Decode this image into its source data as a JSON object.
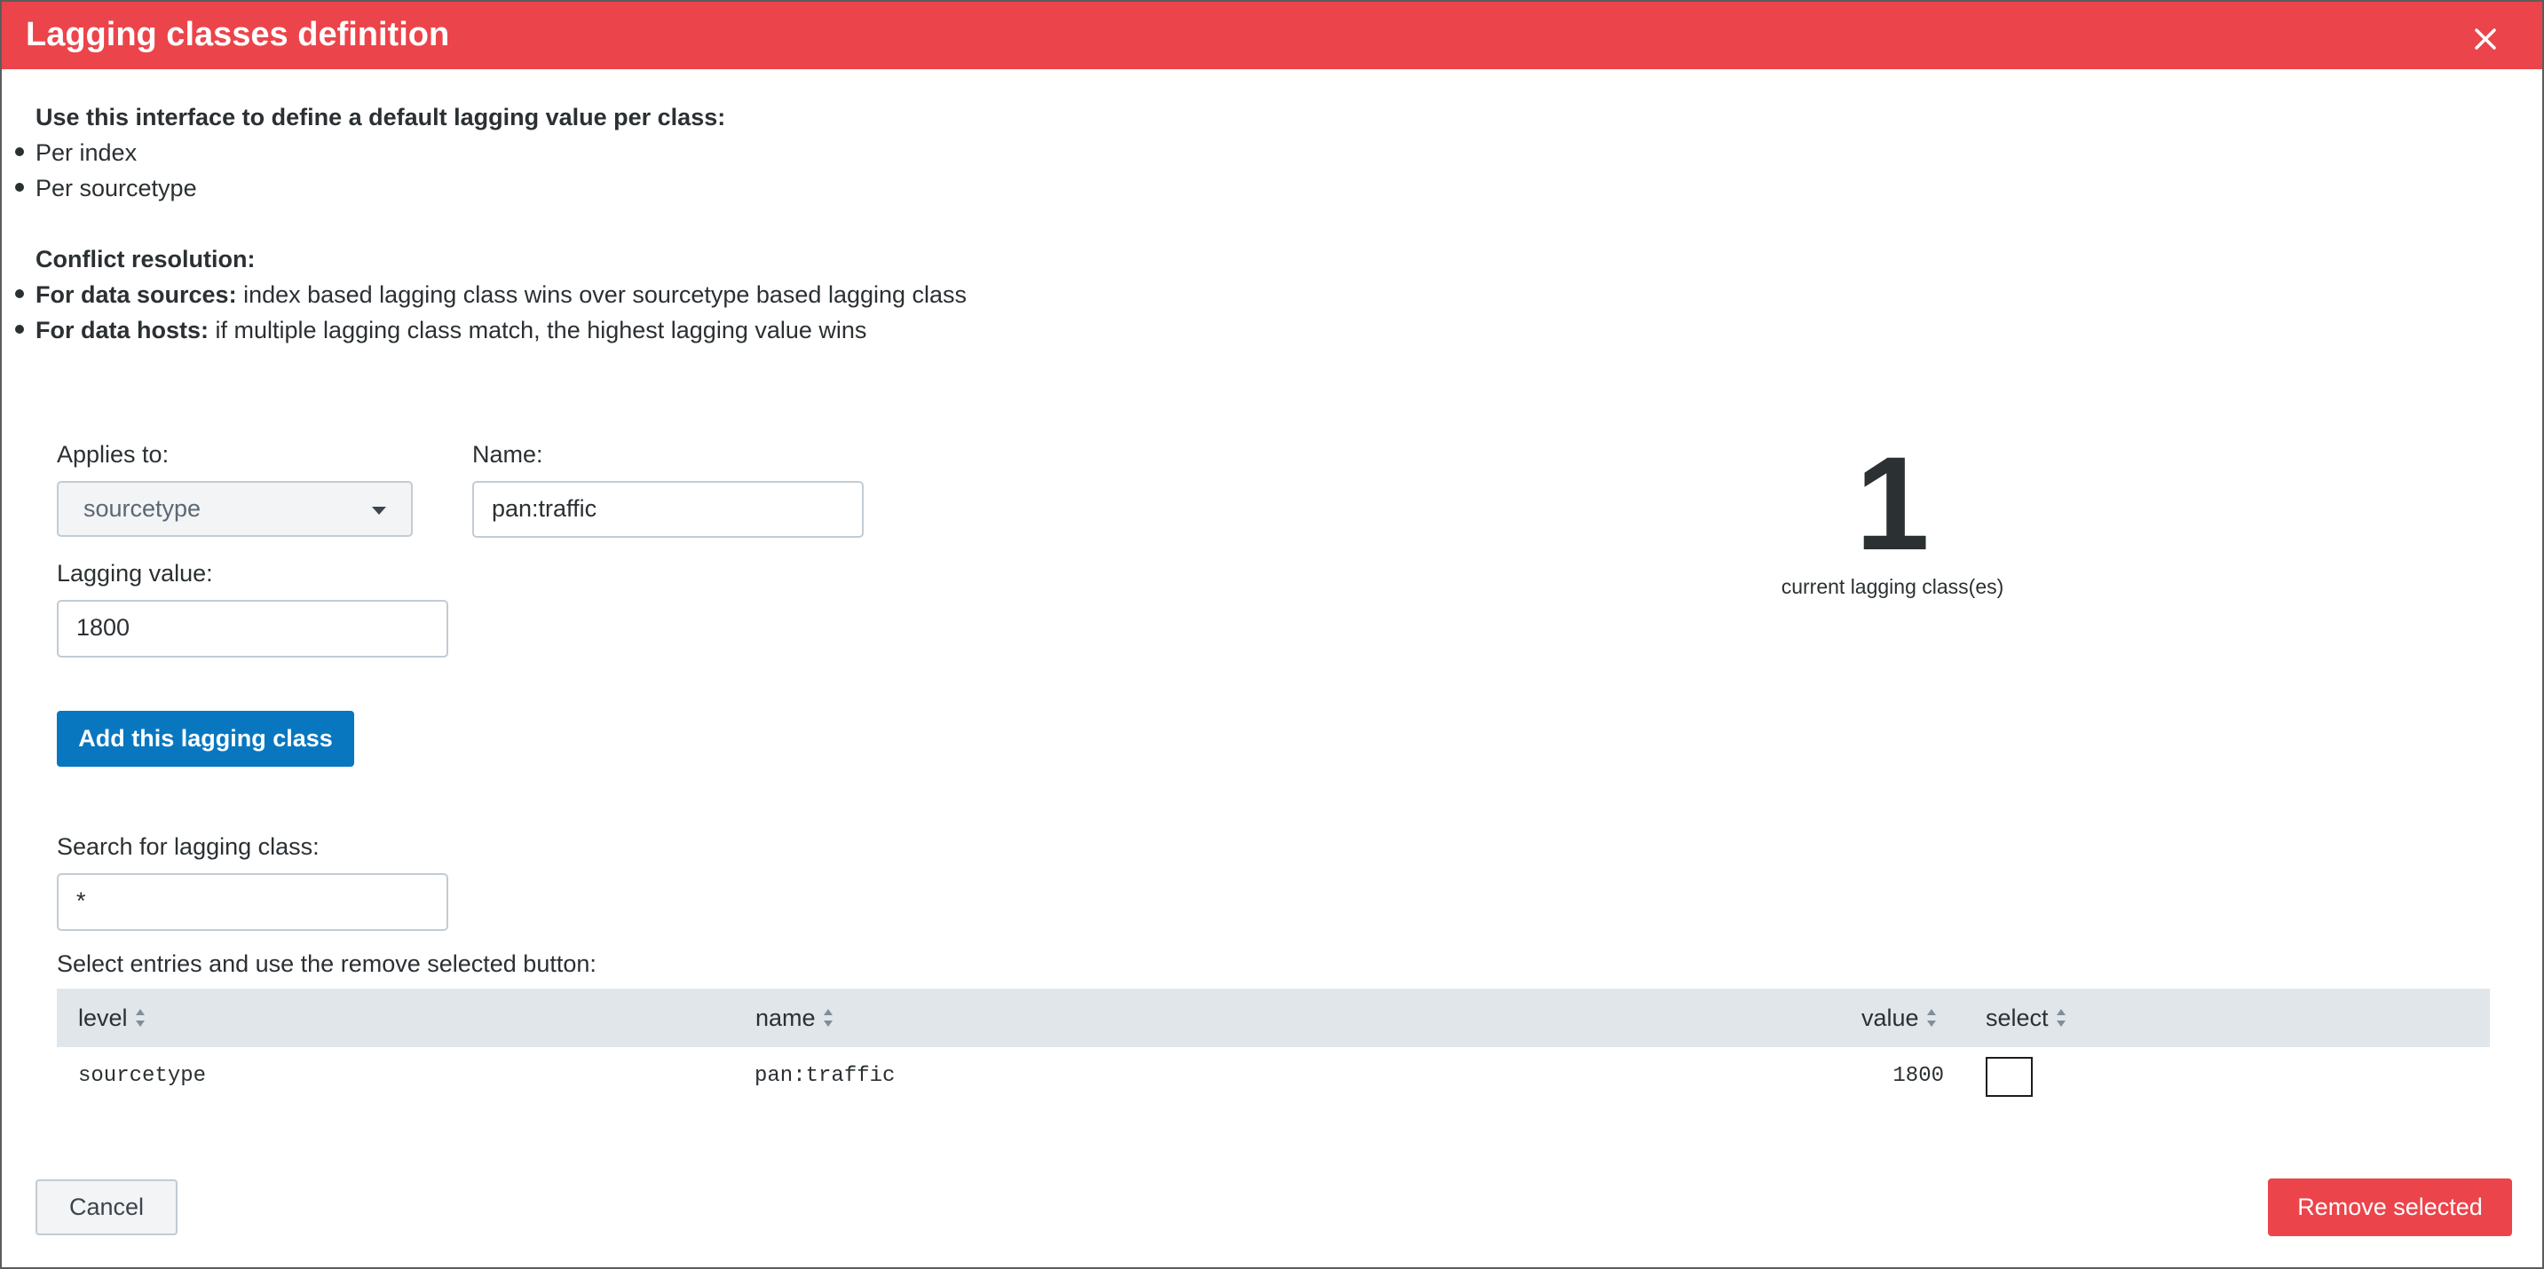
{
  "header": {
    "title": "Lagging classes definition",
    "close_icon": "close-icon"
  },
  "intro": {
    "heading": "Use this interface to define a default lagging value per class:",
    "items": [
      "Per index",
      "Per sourcetype"
    ]
  },
  "conflict": {
    "heading": "Conflict resolution:",
    "items": [
      {
        "label": "For data sources:",
        "text": " index based lagging class wins over sourcetype based lagging class"
      },
      {
        "label": "For data hosts:",
        "text": " if multiple lagging class match, the highest lagging value wins"
      }
    ]
  },
  "form": {
    "applies_to_label": "Applies to:",
    "applies_to_value": "sourcetype",
    "name_label": "Name:",
    "name_value": "pan:traffic",
    "lagging_label": "Lagging value:",
    "lagging_value": "1800",
    "add_button": "Add this lagging class"
  },
  "summary": {
    "count": "1",
    "caption": "current lagging class(es)"
  },
  "search": {
    "label": "Search for lagging class:",
    "value": "*"
  },
  "table": {
    "instruction": "Select entries and use the remove selected button:",
    "columns": [
      "level",
      "name",
      "value",
      "select"
    ],
    "rows": [
      {
        "level": "sourcetype",
        "name": "pan:traffic",
        "value": "1800",
        "selected": false
      }
    ]
  },
  "footer": {
    "cancel": "Cancel",
    "remove": "Remove selected"
  },
  "colors": {
    "header": "#ec444b",
    "primary": "#0877c0",
    "danger": "#ec444b",
    "table_header": "#e1e6eb"
  }
}
